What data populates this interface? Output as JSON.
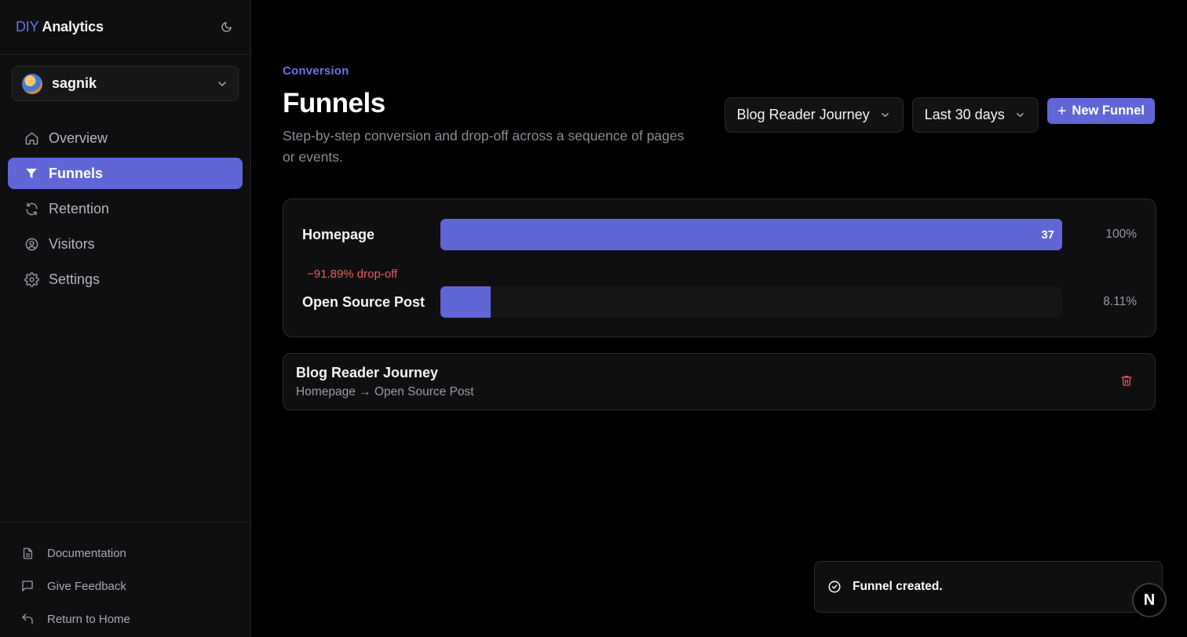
{
  "brand": {
    "prefix": "DIY",
    "name": "Analytics"
  },
  "user": {
    "name": "sagnik"
  },
  "nav": [
    {
      "label": "Overview",
      "icon": "home-icon"
    },
    {
      "label": "Funnels",
      "icon": "filter-icon",
      "active": true
    },
    {
      "label": "Retention",
      "icon": "refresh-icon"
    },
    {
      "label": "Visitors",
      "icon": "user-circle-icon"
    },
    {
      "label": "Settings",
      "icon": "gear-icon"
    }
  ],
  "sidebar_bottom": [
    {
      "label": "Documentation",
      "icon": "document-icon"
    },
    {
      "label": "Give Feedback",
      "icon": "message-icon"
    },
    {
      "label": "Return to Home",
      "icon": "return-icon"
    }
  ],
  "header": {
    "eyebrow": "Conversion",
    "title": "Funnels",
    "subtitle": "Step-by-step conversion and drop-off across a sequence of pages or events."
  },
  "controls": {
    "funnel_select": "Blog Reader Journey",
    "range_select": "Last 30 days",
    "new_button": "New Funnel"
  },
  "funnel_steps": [
    {
      "label": "Homepage",
      "count": "37",
      "percent": "100%",
      "fill": 1.0
    },
    {
      "label": "Open Source Post",
      "count": "",
      "percent": "8.11%",
      "fill": 0.0811
    }
  ],
  "dropoff": "−91.89% drop-off",
  "funnel_list": {
    "name": "Blog Reader Journey",
    "steps": "Homepage → Open Source Post"
  },
  "toast": {
    "message": "Funnel created."
  },
  "badge": {
    "letter": "N"
  },
  "colors": {
    "accent": "#6066d6",
    "danger": "#e35d5d",
    "background": "#000000"
  }
}
